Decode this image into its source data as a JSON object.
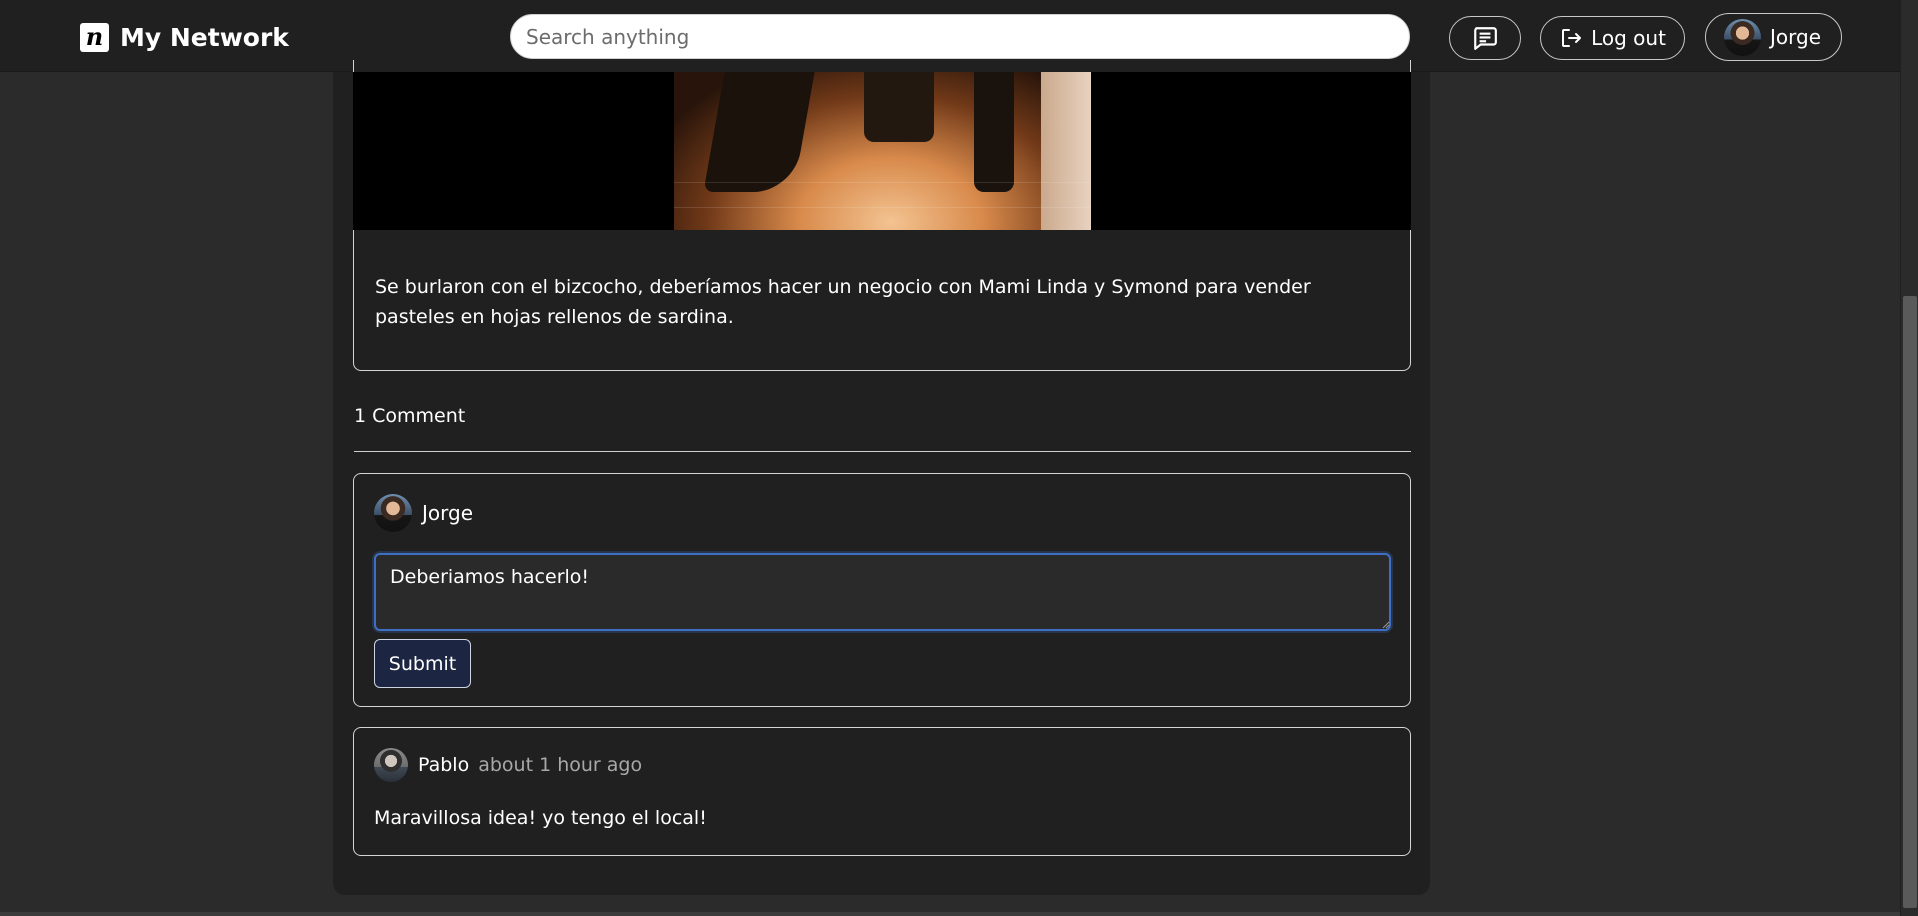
{
  "header": {
    "brand_logo": "n",
    "brand_name": "My Network",
    "search_placeholder": "Search anything",
    "messages_icon": "message-icon",
    "logout_label": "Log out",
    "user_name": "Jorge"
  },
  "post": {
    "text": "Se burlaron con el bizcocho, deberíamos hacer un negocio con Mami Linda y Symond para vender pasteles en hojas rellenos de sardina."
  },
  "comments": {
    "count_label": "1 Comment",
    "form": {
      "user_name": "Jorge",
      "input_value": "Deberiamos hacerlo!",
      "submit_label": "Submit"
    },
    "items": [
      {
        "author": "Pablo",
        "time": "about 1 hour ago",
        "text": "Maravillosa idea! yo tengo el local!"
      }
    ]
  },
  "colors": {
    "background": "#2b2b2b",
    "panel": "#202020",
    "submit_button": "#1c2541",
    "input_focus": "#3f6fc4"
  }
}
